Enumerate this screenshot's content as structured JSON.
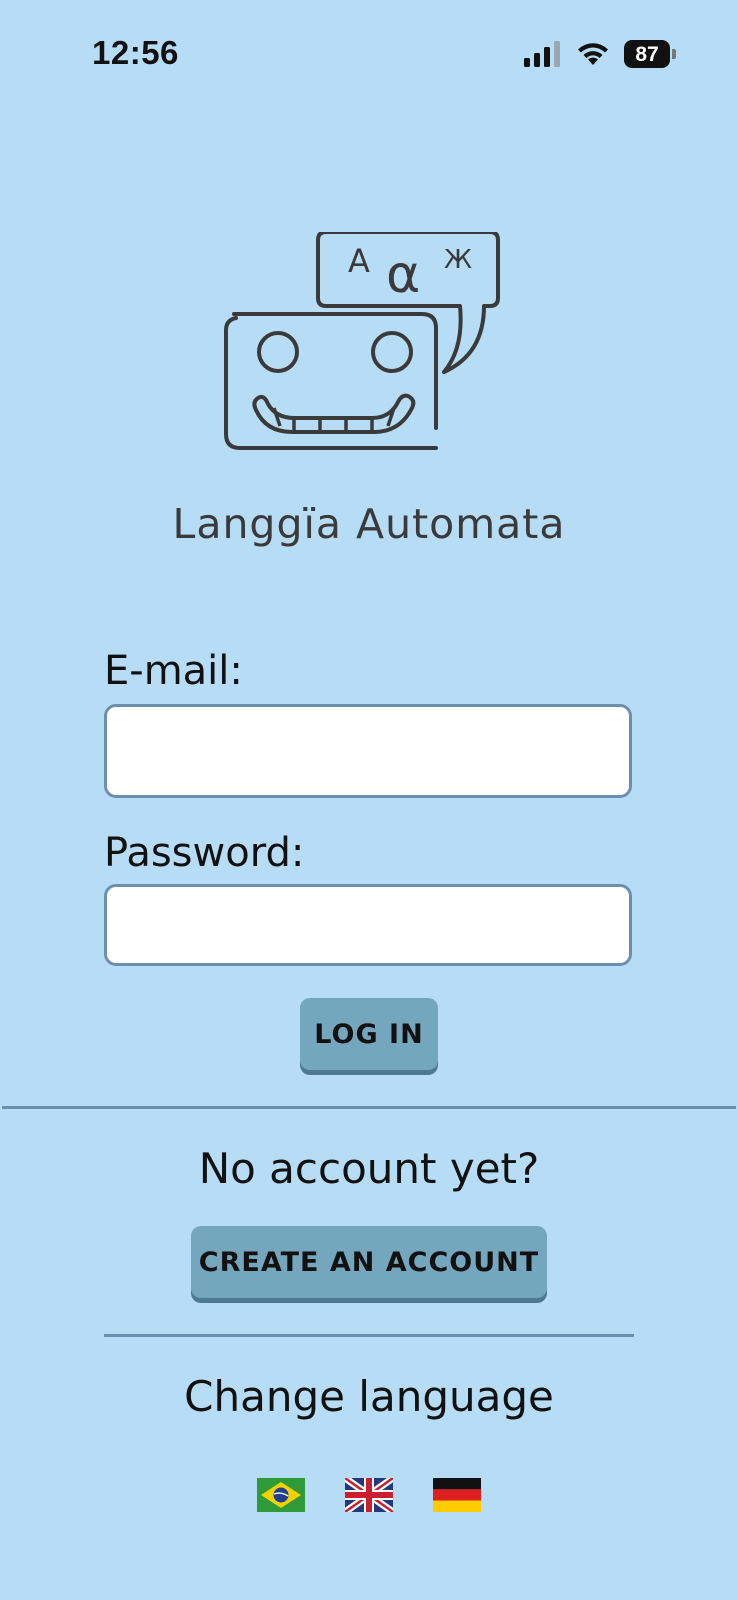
{
  "status_bar": {
    "time": "12:56",
    "battery": "87",
    "icons": [
      "signal-icon",
      "wifi-icon",
      "battery-icon"
    ]
  },
  "app": {
    "title": "Langgïa Automata",
    "logo_glyphs": {
      "latin": "A",
      "greek": "α",
      "cyrillic": "Ж"
    }
  },
  "login": {
    "email_label": "E-mail:",
    "email_value": "",
    "password_label": "Password:",
    "password_value": "",
    "login_button": "LOG IN"
  },
  "signup": {
    "prompt": "No account yet?",
    "create_button": "CREATE AN ACCOUNT"
  },
  "language": {
    "heading": "Change language",
    "flags": [
      "brazil-flag-icon",
      "uk-flag-icon",
      "germany-flag-icon"
    ]
  },
  "colors": {
    "background": "#b7ddf6",
    "button": "#74a6bd",
    "border": "#6d8fae",
    "logo_stroke": "#3a3a3a"
  }
}
